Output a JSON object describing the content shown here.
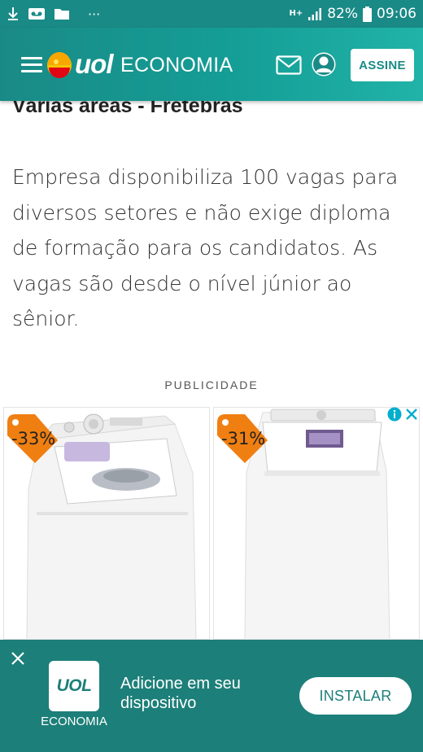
{
  "status_bar": {
    "battery_text": "82%",
    "time": "09:06",
    "more_dots": "···",
    "network_label": "H+"
  },
  "header": {
    "brand": "uol",
    "section": "ECONOMIA",
    "subscribe_label": "ASSINE",
    "colors": {
      "primary": "#1a8a86",
      "accent": "#21b3a8"
    }
  },
  "article": {
    "previous_title": "Várias áreas - Fretebras",
    "summary": "Empresa disponibiliza 100 vagas para diversos setores e não exige diploma de formação para os candidatos. As vagas são desde o nível júnior ao sênior."
  },
  "ad": {
    "label": "PUBLICIDADE",
    "products": [
      {
        "discount": "-33%",
        "icon": "washing-machine-image"
      },
      {
        "discount": "-31%",
        "icon": "washing-machine-image"
      }
    ],
    "tag_color": "#f07f12"
  },
  "install_banner": {
    "app_icon_text": "UOL",
    "app_caption": "ECONOMIA",
    "message": "Adicione em seu dispositivo",
    "install_label": "INSTALAR"
  }
}
